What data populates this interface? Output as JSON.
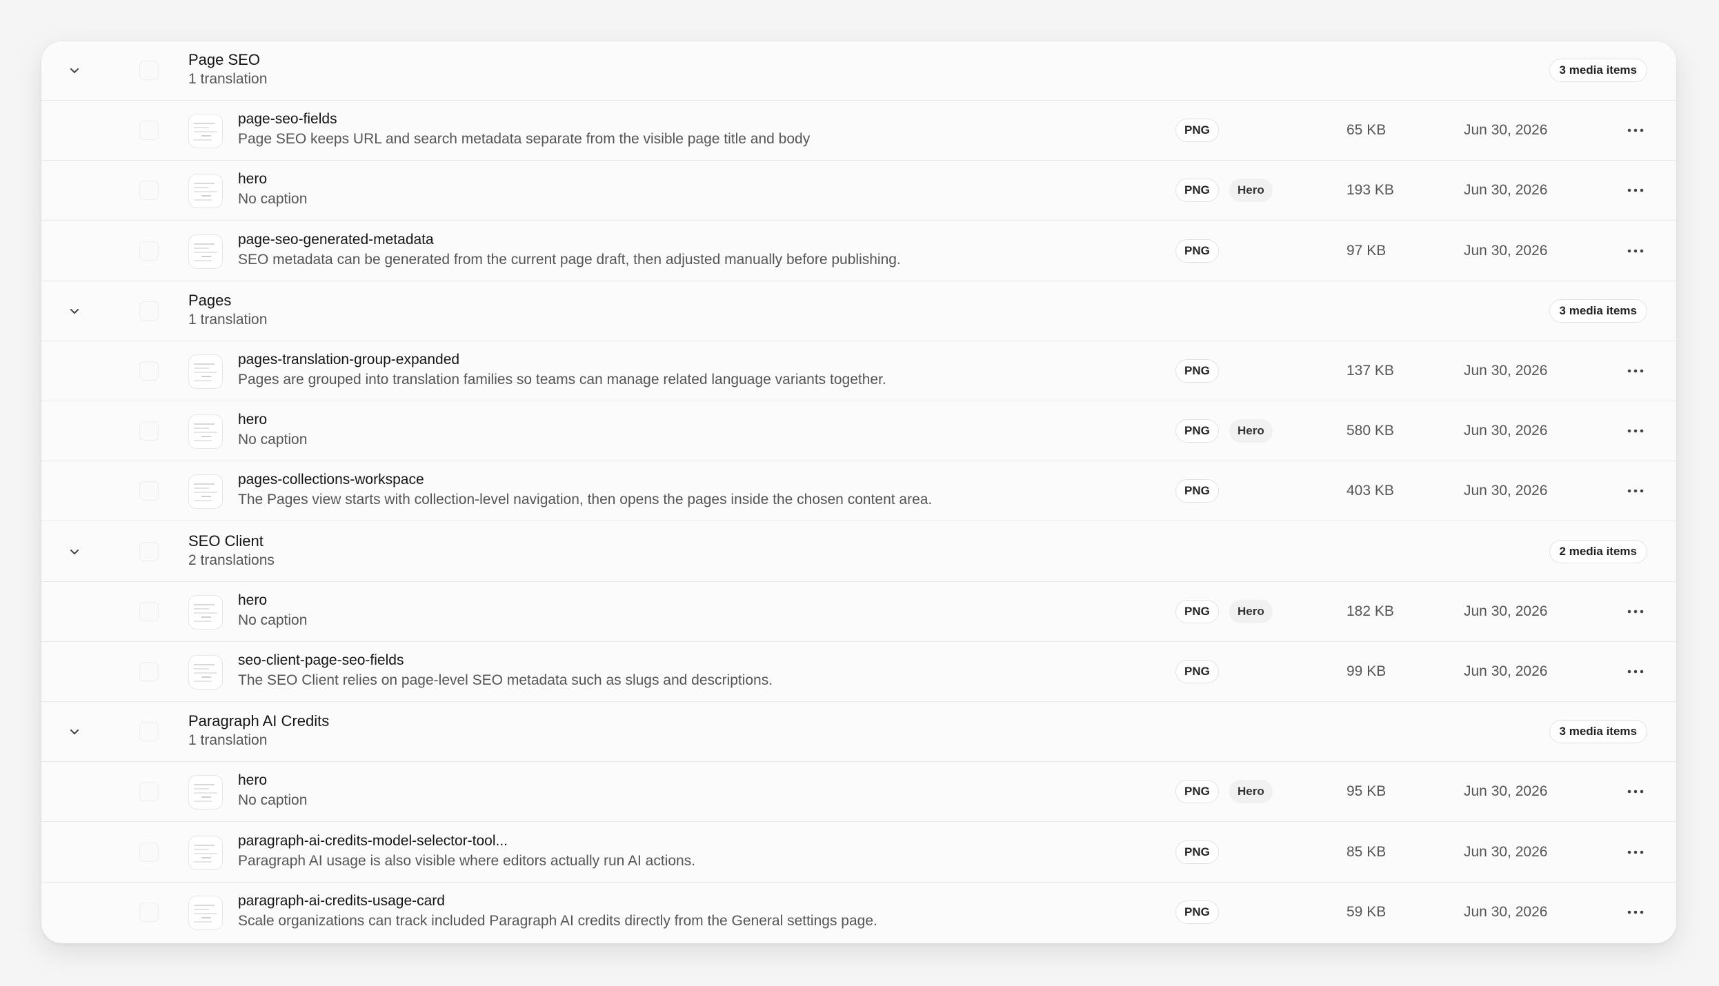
{
  "groups": [
    {
      "title": "Page SEO",
      "subtitle": "1 translation",
      "count": "3 media items",
      "items": [
        {
          "name": "page-seo-fields",
          "caption": "Page SEO keeps URL and search metadata separate from the visible page title and body",
          "format": "PNG",
          "hero": "",
          "size": "65 KB",
          "date": "Jun 30, 2026"
        },
        {
          "name": "hero",
          "caption": "No caption",
          "format": "PNG",
          "hero": "Hero",
          "size": "193 KB",
          "date": "Jun 30, 2026"
        },
        {
          "name": "page-seo-generated-metadata",
          "caption": "SEO metadata can be generated from the current page draft, then adjusted manually before publishing.",
          "format": "PNG",
          "hero": "",
          "size": "97 KB",
          "date": "Jun 30, 2026"
        }
      ]
    },
    {
      "title": "Pages",
      "subtitle": "1 translation",
      "count": "3 media items",
      "items": [
        {
          "name": "pages-translation-group-expanded",
          "caption": "Pages are grouped into translation families so teams can manage related language variants together.",
          "format": "PNG",
          "hero": "",
          "size": "137 KB",
          "date": "Jun 30, 2026"
        },
        {
          "name": "hero",
          "caption": "No caption",
          "format": "PNG",
          "hero": "Hero",
          "size": "580 KB",
          "date": "Jun 30, 2026"
        },
        {
          "name": "pages-collections-workspace",
          "caption": "The Pages view starts with collection-level navigation, then opens the pages inside the chosen content area.",
          "format": "PNG",
          "hero": "",
          "size": "403 KB",
          "date": "Jun 30, 2026"
        }
      ]
    },
    {
      "title": "SEO Client",
      "subtitle": "2 translations",
      "count": "2 media items",
      "items": [
        {
          "name": "hero",
          "caption": "No caption",
          "format": "PNG",
          "hero": "Hero",
          "size": "182 KB",
          "date": "Jun 30, 2026"
        },
        {
          "name": "seo-client-page-seo-fields",
          "caption": "The SEO Client relies on page-level SEO metadata such as slugs and descriptions.",
          "format": "PNG",
          "hero": "",
          "size": "99 KB",
          "date": "Jun 30, 2026"
        }
      ]
    },
    {
      "title": "Paragraph AI Credits",
      "subtitle": "1 translation",
      "count": "3 media items",
      "items": [
        {
          "name": "hero",
          "caption": "No caption",
          "format": "PNG",
          "hero": "Hero",
          "size": "95 KB",
          "date": "Jun 30, 2026"
        },
        {
          "name": "paragraph-ai-credits-model-selector-tool...",
          "caption": "Paragraph AI usage is also visible where editors actually run AI actions.",
          "format": "PNG",
          "hero": "",
          "size": "85 KB",
          "date": "Jun 30, 2026"
        },
        {
          "name": "paragraph-ai-credits-usage-card",
          "caption": "Scale organizations can track included Paragraph AI credits directly from the General settings page.",
          "format": "PNG",
          "hero": "",
          "size": "59 KB",
          "date": "Jun 30, 2026"
        }
      ]
    }
  ],
  "icons": {
    "expand": "chevron-down-icon",
    "row_menu": "more-horizontal-icon",
    "thumbnail": "image-thumbnail-icon"
  }
}
